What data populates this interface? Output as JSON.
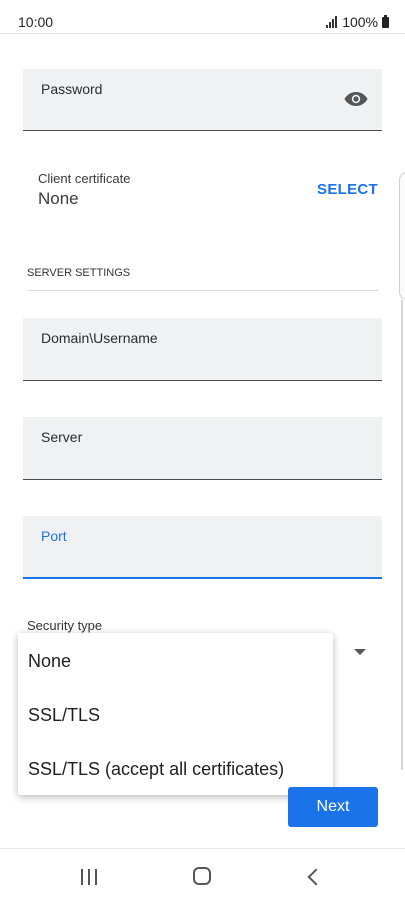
{
  "status_bar": {
    "time": "10:00",
    "battery": "100%"
  },
  "password_field": {
    "label": "Password"
  },
  "client_certificate": {
    "label": "Client certificate",
    "value": "None",
    "action": "SELECT"
  },
  "server_settings": {
    "title": "SERVER SETTINGS",
    "fields": [
      {
        "label": "Domain\\Username"
      },
      {
        "label": "Server"
      },
      {
        "label": "Port",
        "focused": true
      }
    ]
  },
  "security_type": {
    "label": "Security type",
    "options": [
      "None",
      "SSL/TLS",
      "SSL/TLS (accept all certificates)"
    ]
  },
  "next_button": {
    "label": "Next"
  },
  "colors": {
    "accent": "#1a73e8",
    "field_bg": "#f0f1f3"
  }
}
